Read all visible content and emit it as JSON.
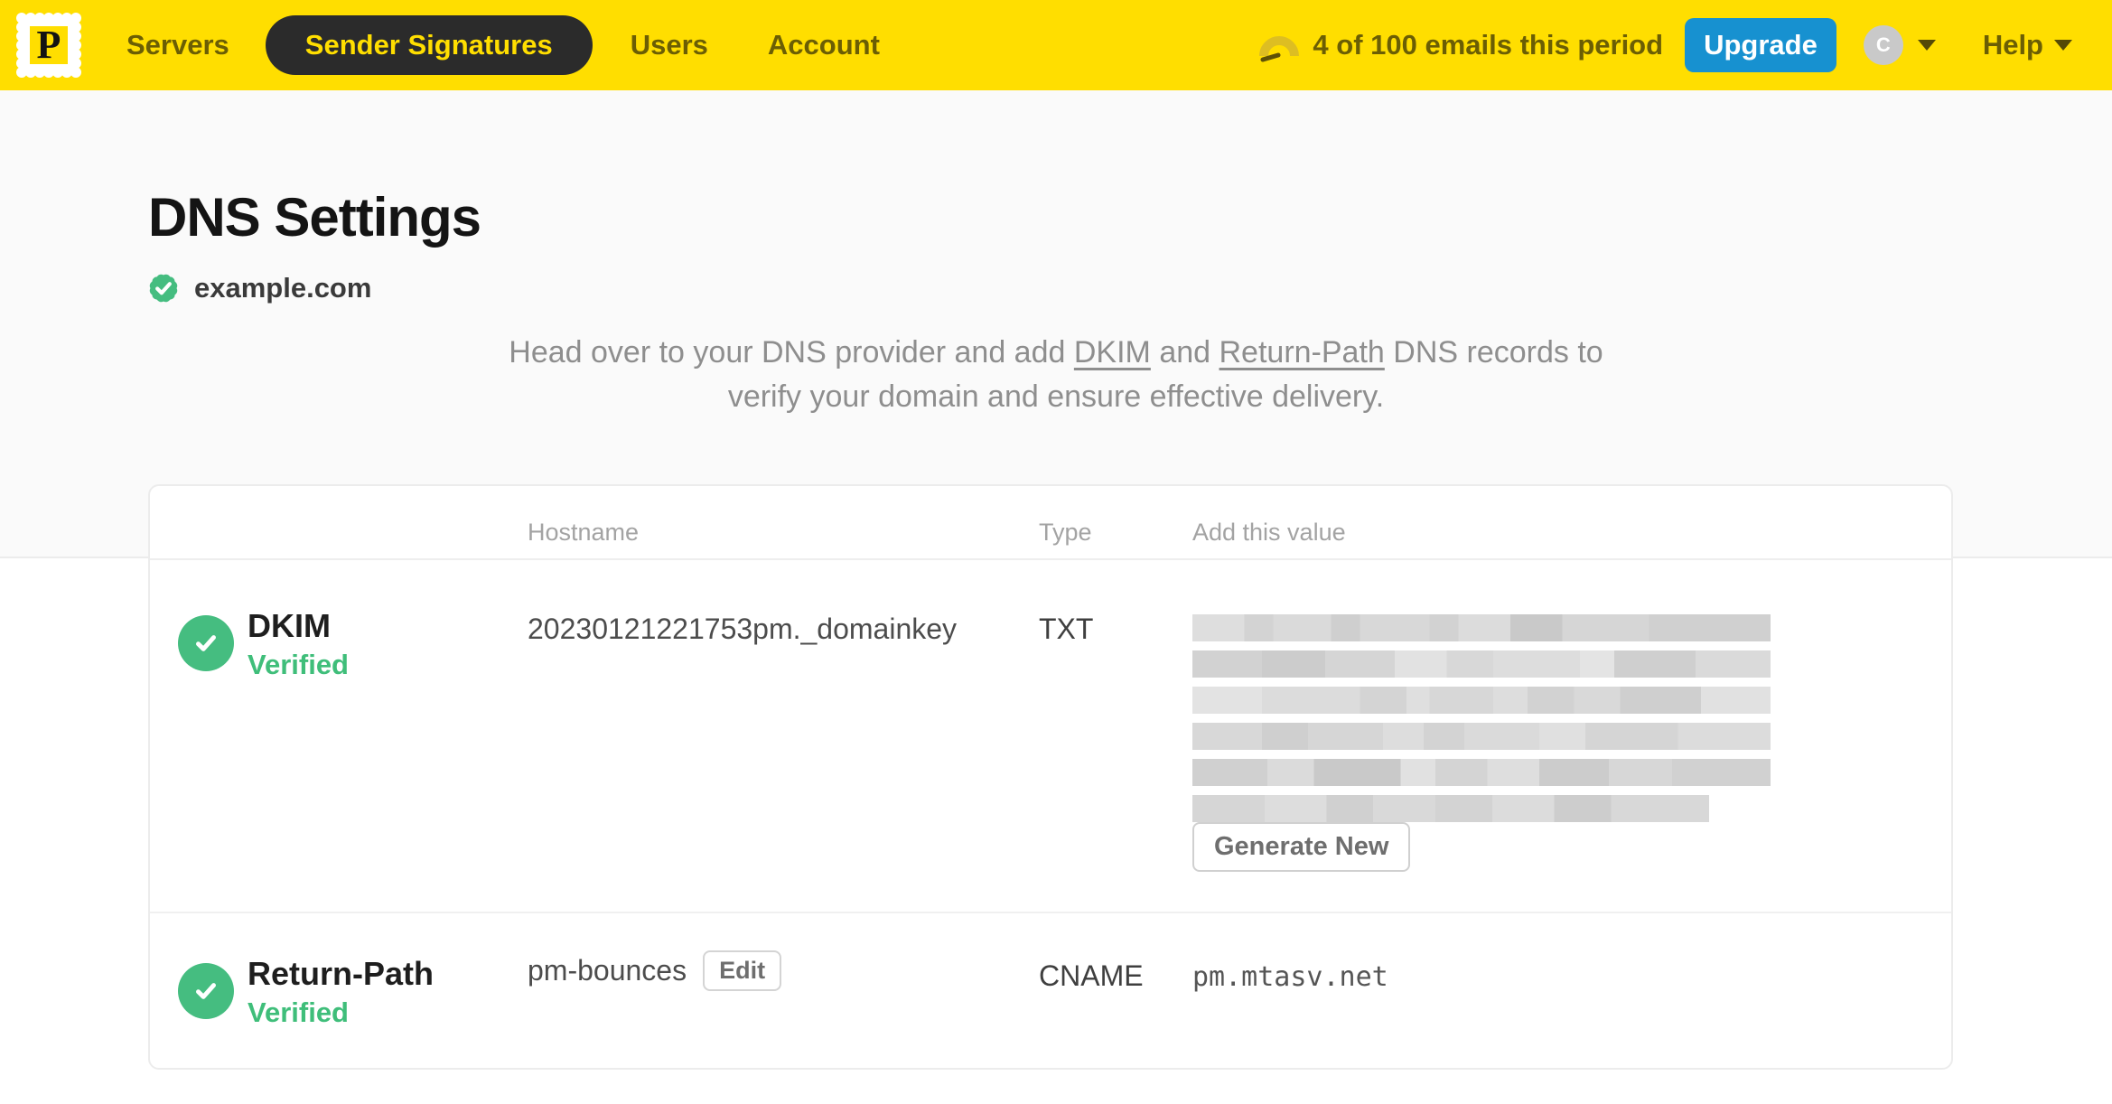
{
  "nav": {
    "brand_initial": "P",
    "items": [
      {
        "label": "Servers",
        "active": false
      },
      {
        "label": "Sender Signatures",
        "active": true
      },
      {
        "label": "Users",
        "active": false
      },
      {
        "label": "Account",
        "active": false
      }
    ],
    "usage_text": "4 of 100 emails this period",
    "upgrade_label": "Upgrade",
    "avatar_initial": "C",
    "help_label": "Help"
  },
  "page": {
    "title": "DNS Settings",
    "domain": "example.com",
    "description": {
      "part1": "Head over to your DNS provider and add ",
      "link1": "DKIM",
      "part2": " and ",
      "link2": "Return-Path",
      "part3": " DNS records to verify your domain and ensure effective delivery."
    }
  },
  "table": {
    "headers": [
      "Hostname",
      "Type",
      "Add this value"
    ],
    "rows": [
      {
        "name": "DKIM",
        "status": "Verified",
        "hostname": "20230121221753pm._domainkey",
        "type": "TXT",
        "value_redacted": true,
        "action": "Generate New"
      },
      {
        "name": "Return-Path",
        "status": "Verified",
        "hostname": "pm-bounces",
        "hostname_action": "Edit",
        "type": "CNAME",
        "value": "pm.mtasv.net"
      }
    ]
  },
  "colors": {
    "brand_yellow": "#FFDE00",
    "nav_text": "#6B5E04",
    "accent_blue": "#1791D0",
    "success_green": "#45BD80",
    "status_green_text": "#3FBE7A"
  }
}
